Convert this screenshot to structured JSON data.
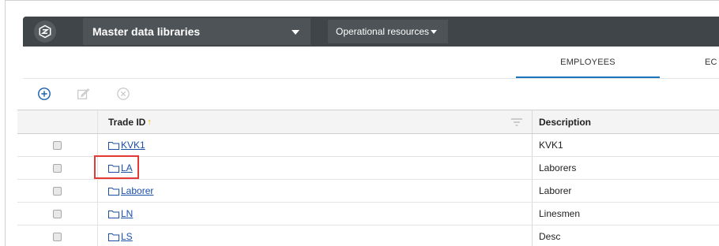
{
  "topbar": {
    "library_select": "Master data libraries",
    "resource_select": "Operational resources"
  },
  "tabs": [
    {
      "label": "EMPLOYEES",
      "active": true
    },
    {
      "label": "EC",
      "active": false
    }
  ],
  "toolbar": {
    "add_icon": "plus-circle-icon",
    "edit_icon": "edit-icon",
    "delete_icon": "close-circle-icon"
  },
  "table": {
    "columns": [
      "Trade ID",
      "Description"
    ],
    "rows": [
      {
        "trade_id": "KVK1",
        "description": "KVK1"
      },
      {
        "trade_id": "LA",
        "description": "Laborers"
      },
      {
        "trade_id": "Laborer",
        "description": "Laborer"
      },
      {
        "trade_id": "LN",
        "description": "Linesmen"
      },
      {
        "trade_id": "LS",
        "description": "Desc"
      }
    ]
  },
  "colors": {
    "topbar_bg": "#3f4548",
    "accent": "#1b75bc",
    "link": "#1a4fa8",
    "highlight": "#e53935",
    "sort_arrow": "#f0b400"
  }
}
